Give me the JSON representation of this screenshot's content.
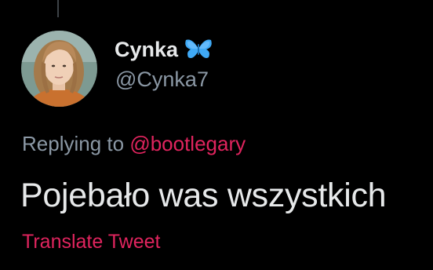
{
  "user": {
    "display_name": "Cynka",
    "badge_icon": "butterfly-icon",
    "handle": "@Cynka7"
  },
  "reply": {
    "prefix": "Replying to",
    "mention": "@bootlegary"
  },
  "tweet": {
    "text": "Pojebało was wszystkich",
    "translate_label": "Translate Tweet"
  },
  "colors": {
    "background": "#000000",
    "primary_text": "#e7e9ea",
    "secondary_text": "#8b98a5",
    "accent": "#e0245e",
    "butterfly": "#3fa9f5"
  }
}
